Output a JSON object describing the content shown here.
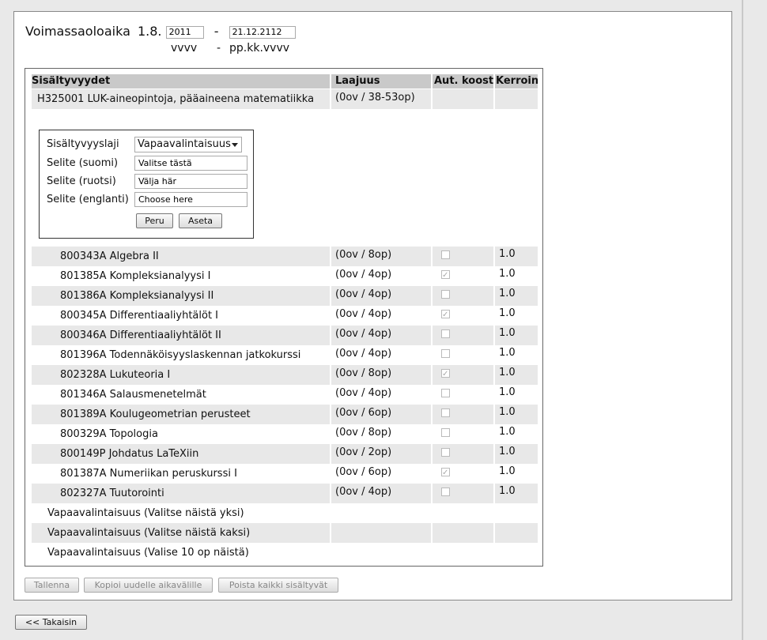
{
  "validity": {
    "label": "Voimassaoloaika",
    "start_prefix": "1.8.",
    "start_year": "2011",
    "dash": "-",
    "end_date": "21.12.2112",
    "format_year": "vvvv",
    "format_dash": "-",
    "format_date": "pp.kk.vvvv"
  },
  "table": {
    "headers": {
      "name": "Sisältyvyydet",
      "laajuus": "Laajuus",
      "aut": "Aut. koost",
      "kerroin": "Kerroin"
    },
    "main_row": {
      "name": "H325001 LUK-aineopintoja, pääaineena matematiikka",
      "laajuus": "(0ov / 38-53op)"
    },
    "form": {
      "type_label": "Sisältyvyyslaji",
      "type_value": "Vapaavalintaisuus",
      "fi_label": "Selite (suomi)",
      "fi_value": "Valitse tästä",
      "sv_label": "Selite (ruotsi)",
      "sv_value": "Välja här",
      "en_label": "Selite (englanti)",
      "en_value": "Choose here",
      "cancel": "Peru",
      "set": "Aseta"
    },
    "courses": [
      {
        "name": "800343A Algebra II",
        "laajuus": "(0ov / 8op)",
        "aut": false,
        "kerroin": "1.0"
      },
      {
        "name": "801385A Kompleksianalyysi I",
        "laajuus": "(0ov / 4op)",
        "aut": true,
        "kerroin": "1.0"
      },
      {
        "name": "801386A Kompleksianalyysi II",
        "laajuus": "(0ov / 4op)",
        "aut": false,
        "kerroin": "1.0"
      },
      {
        "name": "800345A Differentiaaliyhtälöt I",
        "laajuus": "(0ov / 4op)",
        "aut": true,
        "kerroin": "1.0"
      },
      {
        "name": "800346A Differentiaaliyhtälöt II",
        "laajuus": "(0ov / 4op)",
        "aut": false,
        "kerroin": "1.0"
      },
      {
        "name": "801396A Todennäköisyyslaskennan jatkokurssi",
        "laajuus": "(0ov / 4op)",
        "aut": false,
        "kerroin": "1.0"
      },
      {
        "name": "802328A Lukuteoria I",
        "laajuus": "(0ov / 8op)",
        "aut": true,
        "kerroin": "1.0"
      },
      {
        "name": "801346A Salausmenetelmät",
        "laajuus": "(0ov / 4op)",
        "aut": false,
        "kerroin": "1.0"
      },
      {
        "name": "801389A Koulugeometrian perusteet",
        "laajuus": "(0ov / 6op)",
        "aut": false,
        "kerroin": "1.0"
      },
      {
        "name": "800329A Topologia",
        "laajuus": "(0ov / 8op)",
        "aut": false,
        "kerroin": "1.0"
      },
      {
        "name": "800149P Johdatus LaTeXiin",
        "laajuus": "(0ov / 2op)",
        "aut": false,
        "kerroin": "1.0"
      },
      {
        "name": "801387A Numeriikan peruskurssi I",
        "laajuus": "(0ov / 6op)",
        "aut": true,
        "kerroin": "1.0"
      },
      {
        "name": "802327A Tuutorointi",
        "laajuus": "(0ov / 4op)",
        "aut": false,
        "kerroin": "1.0"
      }
    ],
    "groups": [
      "Vapaavalintaisuus (Valitse näistä yksi)",
      "Vapaavalintaisuus (Valitse näistä kaksi)",
      "Vapaavalintaisuus (Valise 10 op näistä)"
    ]
  },
  "actions": {
    "save": "Tallenna",
    "copy": "Kopioi uudelle aikavälille",
    "delete": "Poista kaikki sisältyvät"
  },
  "back": "<< Takaisin"
}
